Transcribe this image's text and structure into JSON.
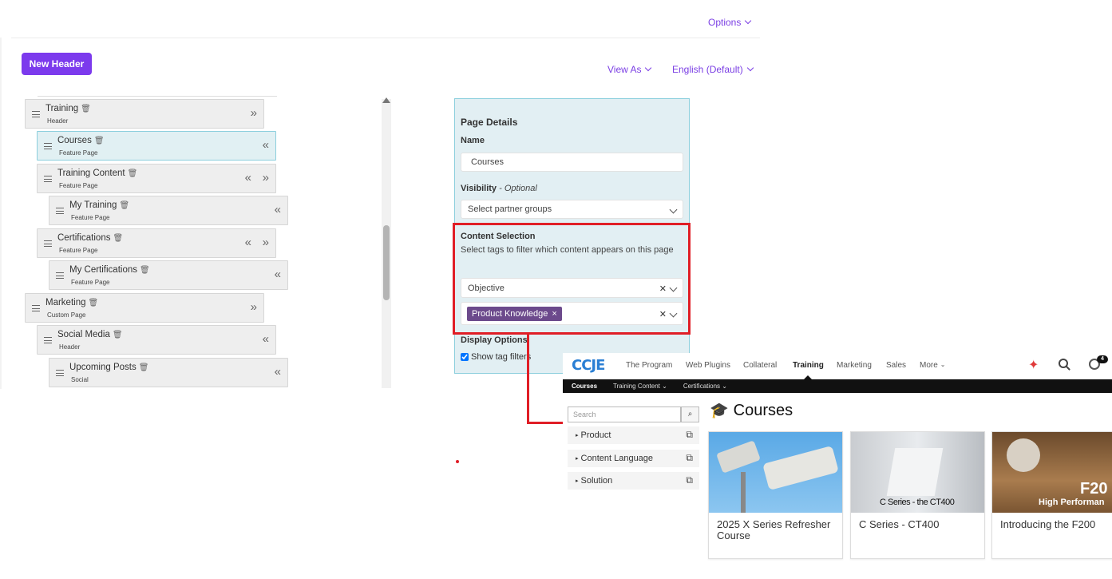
{
  "header": {
    "options_label": "Options",
    "new_header_label": "New Header",
    "view_as_label": "View As",
    "language_label": "English (Default)"
  },
  "tree": {
    "nodes": [
      {
        "title": "Training",
        "type": "Header"
      },
      {
        "title": "Courses",
        "type": "Feature Page"
      },
      {
        "title": "Training Content",
        "type": "Feature Page"
      },
      {
        "title": "My Training",
        "type": "Feature Page"
      },
      {
        "title": "Certifications",
        "type": "Feature Page"
      },
      {
        "title": "My Certifications",
        "type": "Feature Page"
      },
      {
        "title": "Marketing",
        "type": "Custom Page"
      },
      {
        "title": "Social Media",
        "type": "Header"
      },
      {
        "title": "Upcoming Posts",
        "type": "Social"
      }
    ]
  },
  "details": {
    "heading": "Page Details",
    "name_label": "Name",
    "name_value": "Courses",
    "visibility_label": "Visibility",
    "visibility_optional": "- Optional",
    "visibility_placeholder": "Select partner groups",
    "content_label": "Content Selection",
    "content_help": "Select tags to filter which content appears on this page",
    "objective_value": "Objective",
    "tag_value": "Product Knowledge",
    "display_label": "Display Options",
    "show_tag_filters": "Show tag filters"
  },
  "preview": {
    "logo": "CCJE",
    "nav": [
      "The Program",
      "Web Plugins",
      "Collateral",
      "Training",
      "Marketing",
      "Sales",
      "More"
    ],
    "notification_count": "4",
    "subnav": [
      "Courses",
      "Training Content",
      "Certifications"
    ],
    "search_placeholder": "Search",
    "page_title": "Courses",
    "filters": [
      "Product",
      "Content Language",
      "Solution"
    ],
    "cards": [
      {
        "title": "2025 X Series Refresher Course"
      },
      {
        "title": "C Series - CT400",
        "image_text": "C Series - the CT400"
      },
      {
        "title": "Introducing the F200",
        "image_text": "F20",
        "image_subtext": "High Performan"
      }
    ]
  },
  "colors": {
    "accent": "#7c3aed",
    "highlight_red": "#e01e26",
    "panel_blue": "#e2eff3",
    "tag_purple": "#6c4a8c"
  }
}
